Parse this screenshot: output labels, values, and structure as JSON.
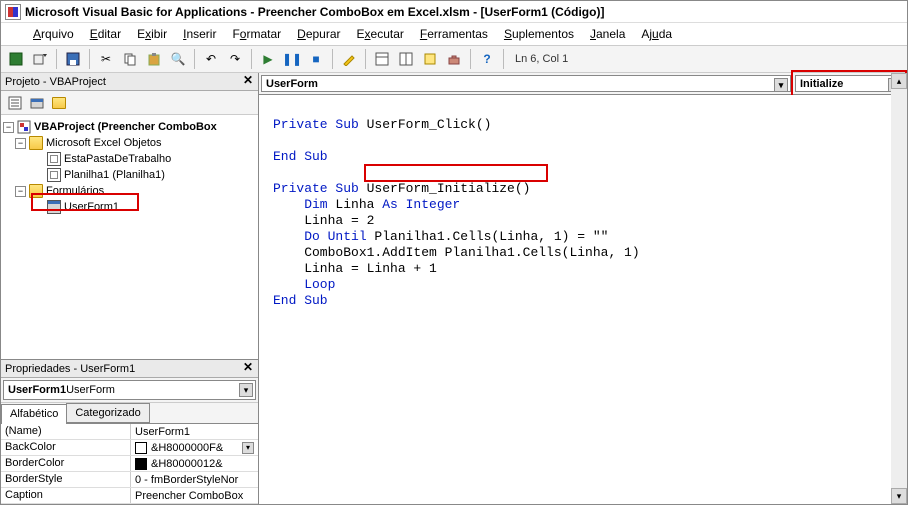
{
  "title": "Microsoft Visual Basic for Applications - Preencher ComboBox em Excel.xlsm - [UserForm1 (Código)]",
  "menu": {
    "arquivo": "Arquivo",
    "editar": "Editar",
    "exibir": "Exibir",
    "inserir": "Inserir",
    "formatar": "Formatar",
    "depurar": "Depurar",
    "executar": "Executar",
    "ferramentas": "Ferramentas",
    "suplementos": "Suplementos",
    "janela": "Janela",
    "ajuda": "Ajuda"
  },
  "toolbar_status": "Ln 6, Col 1",
  "project_panel": {
    "title": "Projeto - VBAProject",
    "root": "VBAProject (Preencher ComboBox",
    "objects_folder": "Microsoft Excel Objetos",
    "obj1": "EstaPastaDeTrabalho",
    "obj2": "Planilha1 (Planilha1)",
    "forms_folder": "Formulários",
    "form1": "UserForm1"
  },
  "props_panel": {
    "title": "Propriedades - UserForm1",
    "selector_bold": "UserForm1",
    "selector_rest": " UserForm",
    "tab_alpha": "Alfabético",
    "tab_cat": "Categorizado",
    "rows": [
      {
        "name": "(Name)",
        "value": "UserForm1"
      },
      {
        "name": "BackColor",
        "value": "&H8000000F&",
        "swatch": "white",
        "dd": true
      },
      {
        "name": "BorderColor",
        "value": "&H80000012&",
        "swatch": "black"
      },
      {
        "name": "BorderStyle",
        "value": "0 - fmBorderStyleNor"
      },
      {
        "name": "Caption",
        "value": "Preencher ComboBox"
      }
    ]
  },
  "code": {
    "left_dd": "UserForm",
    "right_dd": "Initialize",
    "lines": {
      "l1a": "Private Sub",
      "l1b": " UserForm_Click()",
      "blank": "",
      "l2": "End Sub",
      "l3a": "Private Sub",
      "l3b": " UserForm_Initialize()",
      "l4a": "    Dim",
      "l4b": " Linha ",
      "l4c": "As Integer",
      "l5": "    Linha = 2",
      "l6a": "    Do Until",
      "l6b": " Planilha1.Cells(Linha, 1) = \"\"",
      "l7": "    ComboBox1.AddItem Planilha1.Cells(Linha, 1)",
      "l8": "    Linha = Linha + 1",
      "l9": "    Loop",
      "l10": "End Sub"
    }
  }
}
